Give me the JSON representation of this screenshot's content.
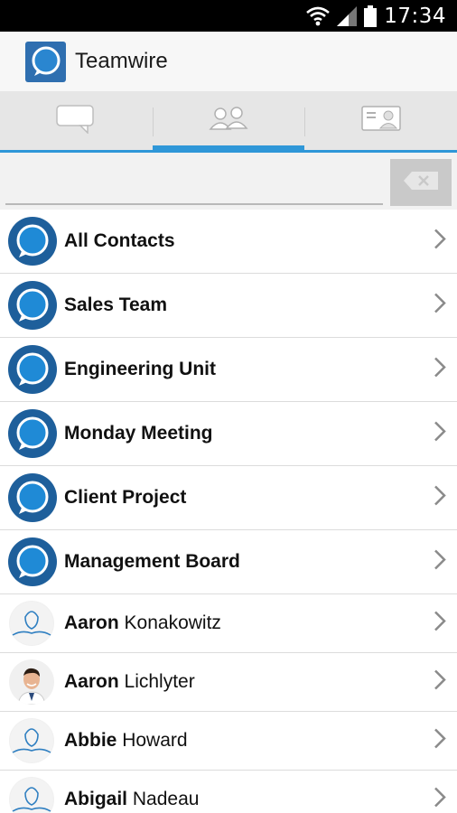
{
  "status_bar": {
    "time": "17:34"
  },
  "app": {
    "title": "Teamwire"
  },
  "tabs": [
    {
      "name": "chats",
      "icon": "chat-bubble-icon",
      "active": false
    },
    {
      "name": "groups",
      "icon": "people-icon",
      "active": true
    },
    {
      "name": "contacts",
      "icon": "contact-card-icon",
      "active": false
    }
  ],
  "search": {
    "value": "",
    "placeholder": ""
  },
  "groups": [
    {
      "label": "All Contacts"
    },
    {
      "label": "Sales Team"
    },
    {
      "label": "Engineering Unit"
    },
    {
      "label": "Monday Meeting"
    },
    {
      "label": "Client Project"
    },
    {
      "label": "Management Board"
    }
  ],
  "contacts": [
    {
      "first": "Aaron",
      "last": "Konakowitz",
      "avatar": "default-avatar"
    },
    {
      "first": "Aaron",
      "last": "Lichlyter",
      "avatar": "photo"
    },
    {
      "first": "Abbie",
      "last": "Howard",
      "avatar": "default-avatar"
    },
    {
      "first": "Abigail",
      "last": "Nadeau",
      "avatar": "default-avatar"
    }
  ],
  "colors": {
    "accent": "#2f97d8",
    "brand": "#1e5f9b"
  }
}
